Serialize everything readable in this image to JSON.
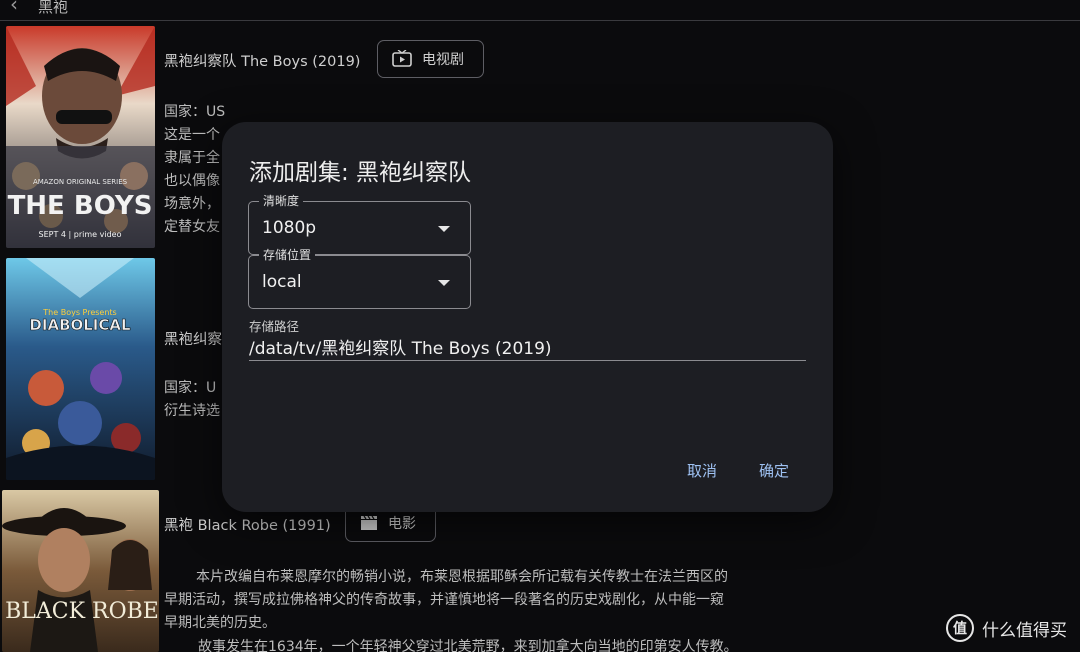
{
  "header": {
    "back_icon": "chevron-left-icon",
    "title": "黑袍"
  },
  "results": [
    {
      "title": "黑袍纠察队 The Boys (2019)",
      "type_label": "电视剧",
      "type_icon": "tv-icon",
      "desc": [
        "国家：US",
        "这是一个",
        "隶属于全",
        "也以偶像",
        "场意外，",
        "定替女友"
      ],
      "poster_text": "THE BOYS",
      "poster_sub": "SEPT 4 | prime video",
      "poster_top": "AMAZON ORIGINAL SERIES"
    },
    {
      "title": "黑袍纠察",
      "desc": [
        "国家：U",
        "衍生诗选"
      ],
      "poster_text": "DIABOLICAL",
      "poster_top": "The Boys Presents"
    },
    {
      "title": "黑袍 Black Robe (1991)",
      "type_label": "电影",
      "type_icon": "clapperboard-icon",
      "desc": [
        "本片改编自布莱恩摩尔的畅销小说，布莱恩根据耶稣会所记载有关传教士在法兰西区的",
        "早期活动，撰写成拉佛格神父的传奇故事，并谨慎地将一段著名的历史戏剧化，从中能一窥",
        "早期北美的历史。",
        "故事发生在1634年，一个年轻神父穿过北美荒野，来到加拿大向当地的印第安人传教。"
      ],
      "poster_text": "BLACK ROBE"
    }
  ],
  "dialog": {
    "title": "添加剧集: 黑袍纠察队",
    "quality": {
      "label": "清晰度",
      "value": "1080p"
    },
    "storage": {
      "label": "存储位置",
      "value": "local"
    },
    "path": {
      "label": "存储路径",
      "value": "/data/tv/黑袍纠察队 The Boys (2019)"
    },
    "cancel_label": "取消",
    "confirm_label": "确定",
    "accent": "#9ec1f2"
  },
  "watermark": {
    "badge": "值",
    "text": "什么值得买"
  }
}
